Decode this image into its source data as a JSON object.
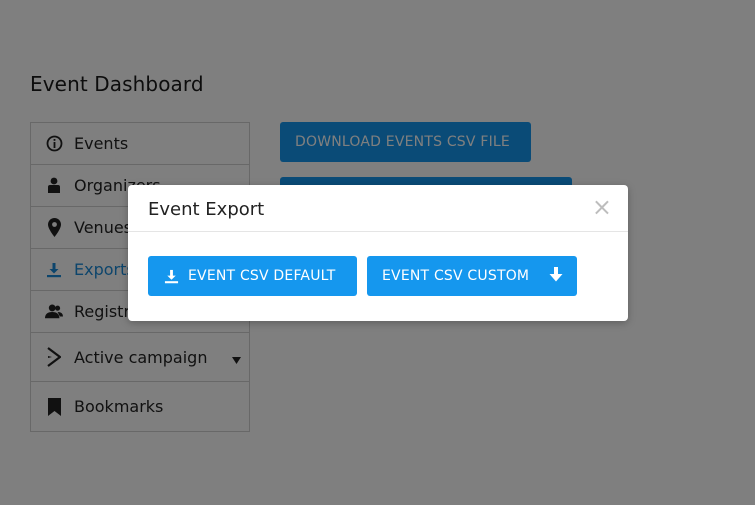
{
  "page": {
    "title": "Event Dashboard"
  },
  "sidebar": {
    "items": [
      {
        "label": "Events",
        "icon": "info-circle-icon"
      },
      {
        "label": "Organizers",
        "icon": "user-icon"
      },
      {
        "label": "Venues",
        "icon": "map-pin-icon"
      },
      {
        "label": "Exports",
        "icon": "download-icon",
        "active": true
      },
      {
        "label": "Registrations",
        "icon": "users-icon"
      },
      {
        "label": "Active campaign",
        "icon": "campaign-arrow-icon"
      },
      {
        "label": "Bookmarks",
        "icon": "bookmark-icon"
      }
    ]
  },
  "main": {
    "download_button_label": "DOWNLOAD EVENTS CSV FILE"
  },
  "modal": {
    "title": "Event Export",
    "close_symbol": "×",
    "default_button_label": "EVENT CSV DEFAULT",
    "custom_button_label": "EVENT CSV CUSTOM"
  },
  "colors": {
    "accent": "#1597ee",
    "active_text": "#1a8bd8",
    "overlay": "rgba(0,0,0,0.5)"
  }
}
